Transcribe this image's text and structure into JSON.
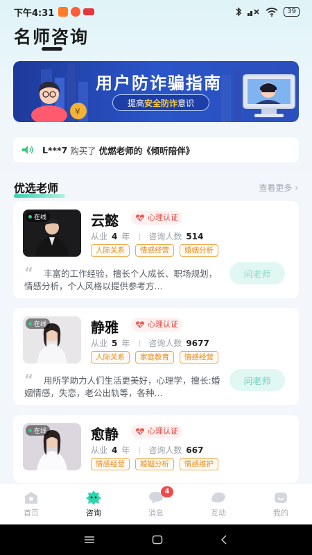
{
  "status_bar": {
    "time": "下午4:31",
    "battery": "39"
  },
  "page_title": "名师咨询",
  "banner": {
    "title": "用户防诈骗指南",
    "pill_pre": "提高",
    "pill_highlight": "安全防诈",
    "pill_post": "意识"
  },
  "notice": {
    "user": "L***7",
    "action": "购买了",
    "product": "优燃老师的《倾听陪伴》"
  },
  "section": {
    "title": "优选老师",
    "see_more": "查看更多"
  },
  "meta_labels": {
    "years_label": "从业",
    "years_unit": "年",
    "consult_label": "咨询人数"
  },
  "online_label": "在线",
  "cert_label": "心理认证",
  "ask_label": "问老师",
  "teachers": [
    {
      "name": "云懿",
      "years": "4",
      "consults": "514",
      "tags": [
        "人际关系",
        "情感经营",
        "婚姻分析"
      ],
      "intro": "丰富的工作经验，擅长个人成长、职场规划，情感分析，个人风格以提供参考方..."
    },
    {
      "name": "静雅",
      "years": "5",
      "consults": "9677",
      "tags": [
        "人际关系",
        "家庭教育",
        "情感经营"
      ],
      "intro": "用所学助力人们生活更美好，心理学，擅长:婚姻情感，失恋，老公出轨等，各种..."
    },
    {
      "name": "愈静",
      "years": "4",
      "consults": "667",
      "tags": [
        "情感经营",
        "婚姻分析",
        "情感维护"
      ],
      "intro": ""
    }
  ],
  "tabbar": [
    {
      "label": "首页",
      "icon": "home-icon"
    },
    {
      "label": "咨询",
      "icon": "consult-icon"
    },
    {
      "label": "消息",
      "icon": "message-icon",
      "badge": "4"
    },
    {
      "label": "互动",
      "icon": "interact-icon"
    },
    {
      "label": "我的",
      "icon": "profile-icon"
    }
  ],
  "colors": {
    "accent": "#2ed3b0",
    "tag": "#e58a1c",
    "cert": "#e0423a",
    "banner": "#2a55c8"
  }
}
